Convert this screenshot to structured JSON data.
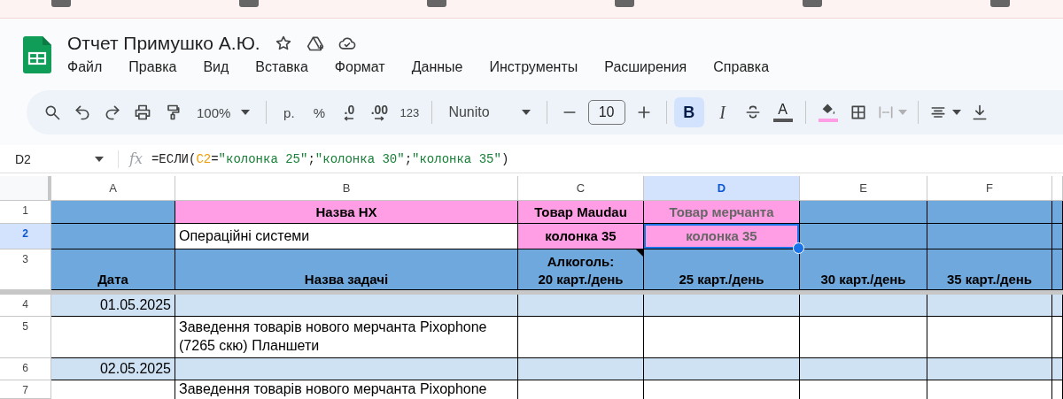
{
  "document": {
    "title": "Отчет Примушко А.Ю."
  },
  "menu": [
    "Файл",
    "Правка",
    "Вид",
    "Вставка",
    "Формат",
    "Данные",
    "Инструменты",
    "Расширения",
    "Справка"
  ],
  "toolbar": {
    "zoom": "100%",
    "currency": "р.",
    "percent": "%",
    "decrease_decimals": ".0",
    "increase_decimals": ".00",
    "number_format": "123",
    "font": "Nunito",
    "font_size": "10",
    "bold": {
      "label": "B",
      "selected": true
    },
    "italic": {
      "label": "I",
      "selected": false
    },
    "text_color": {
      "label": "A",
      "color": "#555555"
    },
    "fill_color": {
      "color": "#ff9ee4"
    }
  },
  "formula_bar": {
    "cell": "D2",
    "fx": "fx",
    "formula": [
      {
        "kind": "plain",
        "text": "=ЕСЛИ("
      },
      {
        "kind": "ref",
        "text": "C2"
      },
      {
        "kind": "plain",
        "text": "="
      },
      {
        "kind": "string",
        "text": "\"колонка 25\""
      },
      {
        "kind": "plain",
        "text": ";"
      },
      {
        "kind": "string",
        "text": "\"колонка 30\""
      },
      {
        "kind": "plain",
        "text": ";"
      },
      {
        "kind": "string",
        "text": "\"колонка 35\""
      },
      {
        "kind": "plain",
        "text": ")"
      }
    ]
  },
  "sheet": {
    "columns": [
      {
        "label": "A",
        "selected": false
      },
      {
        "label": "B",
        "selected": false
      },
      {
        "label": "C",
        "selected": false
      },
      {
        "label": "D",
        "selected": true
      },
      {
        "label": "E",
        "selected": false
      },
      {
        "label": "F",
        "selected": false
      }
    ],
    "rows": [
      {
        "number": "1",
        "selected": false,
        "cells": [
          {
            "color": "#6fa8dc"
          },
          {
            "kind": "heading",
            "text": "Назва НХ",
            "muted": false,
            "color": "#ff9ee4"
          },
          {
            "kind": "heading",
            "text": "Товар Maudau",
            "muted": false,
            "color": "#ff9ee4"
          },
          {
            "kind": "heading",
            "text": "Товар мерчанта",
            "muted": true,
            "color": "#ff9ee4"
          },
          {
            "color": "#6fa8dc"
          },
          {
            "color": "#6fa8dc"
          },
          {
            "color": "#6fa8dc"
          }
        ]
      },
      {
        "number": "2",
        "selected": true,
        "cells": [
          {
            "color": "#6fa8dc"
          },
          {
            "kind": "text",
            "text": "Операційні системи",
            "muted": false,
            "color": "#ffffff"
          },
          {
            "kind": "heading",
            "text": "колонка 35",
            "muted": false,
            "color": "#ff9ee4"
          },
          {
            "kind": "heading",
            "text": "колонка 35",
            "muted": true,
            "color": "#ff9ee4",
            "selected": true
          },
          {
            "color": "#6fa8dc"
          },
          {
            "color": "#6fa8dc"
          },
          {
            "color": "#6fa8dc"
          }
        ]
      },
      {
        "number": "3",
        "selected": false,
        "cells": [
          {
            "kind": "column-heading",
            "text": "Дата",
            "muted": false,
            "color": "#6fa8dc"
          },
          {
            "kind": "column-heading",
            "text": "Назва задачі",
            "muted": false,
            "color": "#6fa8dc"
          },
          {
            "kind": "column-heading",
            "text": "Алкоголь:\n20 карт./день",
            "muted": false,
            "color": "#6fa8dc",
            "note": true
          },
          {
            "kind": "column-heading",
            "text": "25 карт./день",
            "muted": false,
            "color": "#6fa8dc"
          },
          {
            "kind": "column-heading",
            "text": "30 карт./день",
            "muted": false,
            "color": "#6fa8dc"
          },
          {
            "kind": "column-heading",
            "text": "35 карт./день",
            "muted": false,
            "color": "#6fa8dc"
          },
          {
            "color": "#6fa8dc"
          }
        ]
      },
      {
        "number": "4",
        "selected": false,
        "cells": [
          {
            "kind": "date",
            "text": "01.05.2025",
            "muted": false,
            "color": "#cfe2f3"
          },
          {
            "color": "#cfe2f3"
          },
          {
            "color": "#cfe2f3"
          },
          {
            "color": "#cfe2f3"
          },
          {
            "color": "#cfe2f3"
          },
          {
            "color": "#cfe2f3"
          },
          {
            "color": "#cfe2f3"
          }
        ]
      },
      {
        "number": "5",
        "selected": false,
        "cells": [
          {
            "color": "#ffffff"
          },
          {
            "kind": "text",
            "text": "Заведення товарів нового мерчанта Pixophone (7265 скю) Планшети",
            "muted": false,
            "color": "#ffffff"
          },
          {
            "color": "#ffffff"
          },
          {
            "color": "#ffffff"
          },
          {
            "color": "#ffffff"
          },
          {
            "color": "#ffffff"
          },
          {
            "color": "#ffffff"
          }
        ]
      },
      {
        "number": "6",
        "selected": false,
        "cells": [
          {
            "kind": "date",
            "text": "02.05.2025",
            "muted": false,
            "color": "#cfe2f3"
          },
          {
            "color": "#cfe2f3"
          },
          {
            "color": "#cfe2f3"
          },
          {
            "color": "#cfe2f3"
          },
          {
            "color": "#cfe2f3"
          },
          {
            "color": "#cfe2f3"
          },
          {
            "color": "#cfe2f3"
          }
        ]
      },
      {
        "number": "7",
        "selected": false,
        "cells": [
          {
            "color": "#ffffff"
          },
          {
            "kind": "text",
            "text": "Заведення товарів нового мерчанта Pixophone",
            "muted": false,
            "color": "#ffffff"
          },
          {
            "color": "#ffffff"
          },
          {
            "color": "#ffffff"
          },
          {
            "color": "#ffffff"
          },
          {
            "color": "#ffffff"
          },
          {
            "color": "#ffffff"
          }
        ]
      }
    ]
  }
}
